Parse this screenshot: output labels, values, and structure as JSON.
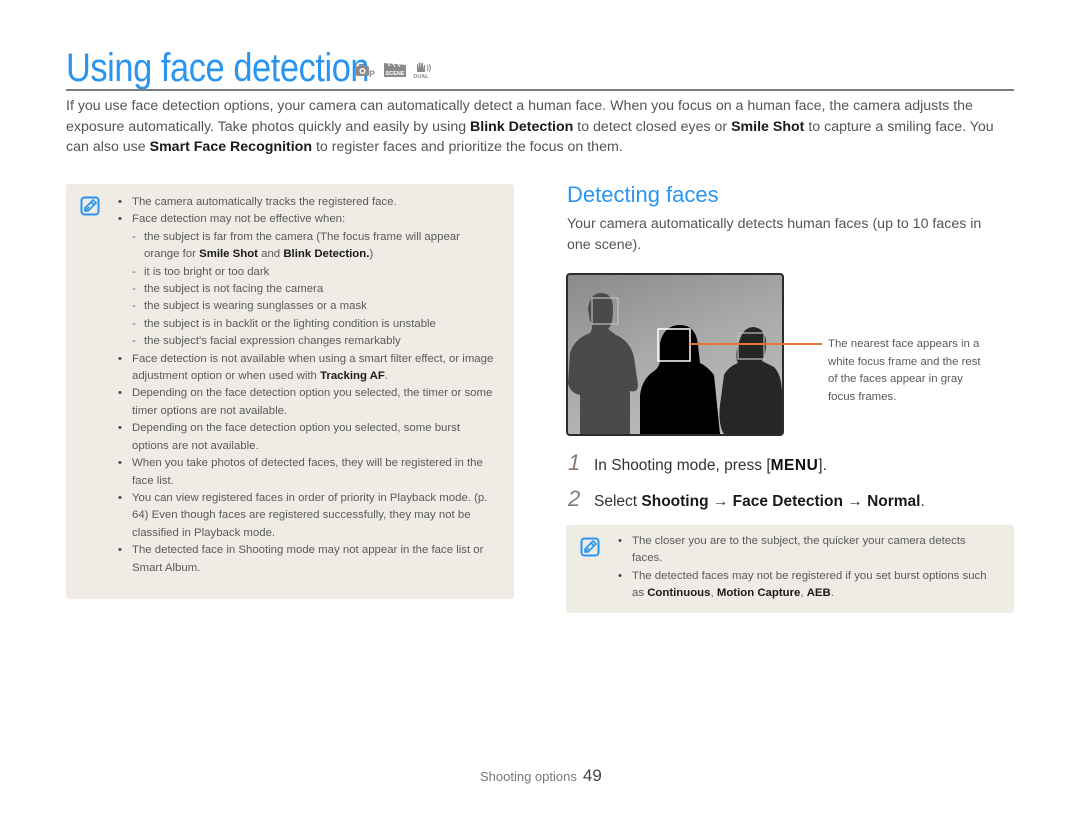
{
  "page": {
    "title": "Using face detection",
    "mode_icons": [
      "smart-auto-camera-icon",
      "scene-icon",
      "dual-is-icon"
    ],
    "mode_icon_labels": {
      "p": "P",
      "scene": "SCENE",
      "dual": "DUAL"
    },
    "intro": {
      "p1": "If you use face detection options, your camera can automatically detect a human face. When you focus on a human face, the camera adjusts the exposure automatically. Take photos quickly and easily by using ",
      "b1": "Blink Detection",
      "p2": " to detect closed eyes or ",
      "b2": "Smile Shot",
      "p3": " to capture a smiling face. You can also use ",
      "b3": "Smart Face Recognition",
      "p4": " to register faces and prioritize the focus on them."
    }
  },
  "left_note": {
    "icon": "note-pencil-icon",
    "item1": "The camera automatically tracks the registered face.",
    "item2": "Face detection may not be effective when:",
    "sub1_a": "the subject is far from the camera (The focus frame will appear orange for ",
    "sub1_b1": "Smile Shot",
    "sub1_c": " and ",
    "sub1_b2": "Blink Detection.",
    "sub1_d": ")",
    "sub2": "it is too bright or too dark",
    "sub3": "the subject is not facing the camera",
    "sub4": "the subject is wearing sunglasses or a mask",
    "sub5": "the subject is in backlit or the lighting condition is unstable",
    "sub6": "the subject's facial expression changes remarkably",
    "item3_a": "Face detection is not available when using a smart filter effect, or image adjustment option or when used with ",
    "item3_b": "Tracking AF",
    "item3_c": ".",
    "item4": "Depending on the face detection option you selected, the timer or some timer options are not available.",
    "item5": "Depending on the face detection option you selected, some burst options are not available.",
    "item6": "When you take photos of detected faces, they will be registered in the face list.",
    "item7": "You can view registered faces in order of priority in Playback mode. (p. 64) Even though faces are registered successfully, they may  not be classified in Playback mode.",
    "item8": "The detected face in Shooting mode may not appear in the face list or Smart Album."
  },
  "detecting": {
    "title": "Detecting faces",
    "desc": "Your camera automatically detects human faces (up to 10 faces in one scene).",
    "callout": "The nearest face appears in a white focus frame and the rest of the faces appear in gray focus frames.",
    "callout_color": "#e8752a",
    "steps": [
      {
        "num": "1",
        "a": "In Shooting mode, press [",
        "key": "MENU",
        "c": "]."
      },
      {
        "num": "2",
        "a": "Select ",
        "b1": "Shooting",
        "arrow1": " → ",
        "b2": "Face Detection",
        "arrow2": " → ",
        "b3": "Normal",
        "c": "."
      }
    ]
  },
  "right_note": {
    "icon": "note-pencil-icon",
    "item1": "The closer you are to the subject, the quicker your camera detects faces.",
    "item2_a": "The detected faces may not be registered if you set burst options such as ",
    "item2_b1": "Continuous",
    "item2_c": ", ",
    "item2_b2": "Motion Capture",
    "item2_d": ", ",
    "item2_b3": "AEB",
    "item2_e": "."
  },
  "footer": {
    "section": "Shooting options",
    "page_number": "49"
  },
  "colors": {
    "accent": "#2a95ef",
    "note_bg": "#efece6"
  }
}
